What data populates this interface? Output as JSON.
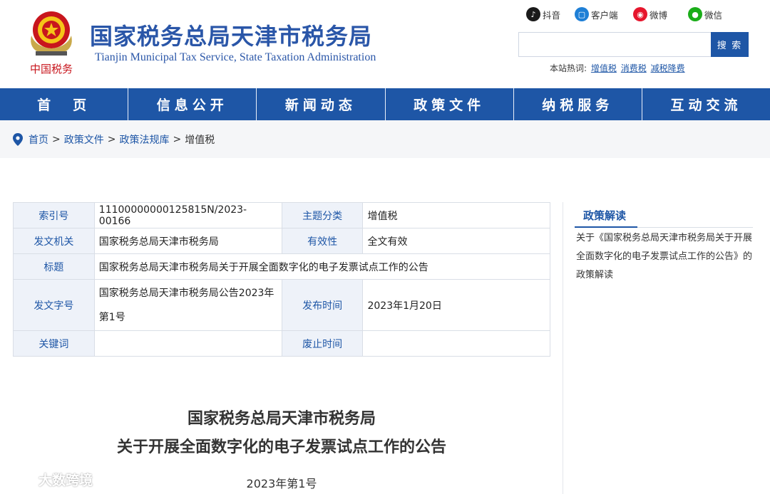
{
  "header": {
    "title": "国家税务总局天津市税务局",
    "subtitle": "Tianjin Municipal Tax Service, State Taxation Administration",
    "emblem_caption": "中国税务"
  },
  "social": {
    "douyin": "抖音",
    "client": "客户端",
    "weibo": "微博",
    "wechat": "微信"
  },
  "search": {
    "placeholder": "",
    "button": "搜 索",
    "hot_label": "本站热词:",
    "hot_words": [
      "增值税",
      "消费税",
      "减税降费"
    ]
  },
  "nav": [
    "首　页",
    "信息公开",
    "新闻动态",
    "政策文件",
    "纳税服务",
    "互动交流"
  ],
  "breadcrumb": {
    "items": [
      "首页",
      "政策文件",
      "政策法规库"
    ],
    "current": "增值税",
    "sep": ">"
  },
  "meta": {
    "index_label": "索引号",
    "index_value": "11100000000125815N/2023-00166",
    "topic_label": "主题分类",
    "topic_value": "增值税",
    "issuer_label": "发文机关",
    "issuer_value": "国家税务总局天津市税务局",
    "validity_label": "有效性",
    "validity_value": "全文有效",
    "title_label": "标题",
    "title_value": "国家税务总局天津市税务局关于开展全面数字化的电子发票试点工作的公告",
    "docno_label": "发文字号",
    "docno_value": "国家税务总局天津市税务局公告2023年第1号",
    "pubdate_label": "发布时间",
    "pubdate_value": "2023年1月20日",
    "keyword_label": "关键词",
    "keyword_value": "",
    "abolish_label": "废止时间",
    "abolish_value": ""
  },
  "sidebar": {
    "heading": "政策解读",
    "link": "关于《国家税务总局天津市税务局关于开展全面数字化的电子发票试点工作的公告》的政策解读"
  },
  "document": {
    "title_line1": "国家税务总局天津市税务局",
    "title_line2": "关于开展全面数字化的电子发票试点工作的公告",
    "number": "2023年第1号"
  },
  "watermark": "大数跨境",
  "colors": {
    "brand_blue": "#1e56a6",
    "emblem_red": "#c8161d",
    "label_bg": "#eef2f9"
  }
}
